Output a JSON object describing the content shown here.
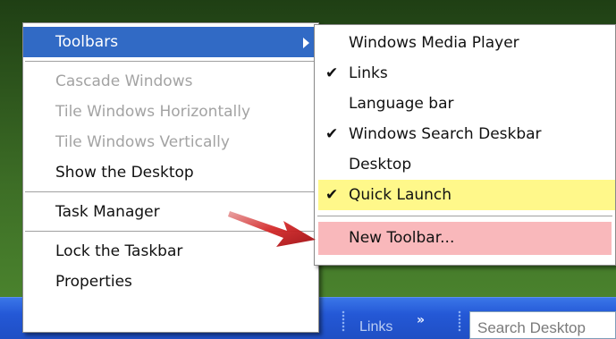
{
  "context_menu": {
    "items": [
      {
        "label": "Toolbars",
        "state": "highlighted",
        "has_submenu": true
      },
      {
        "label": "Cascade Windows",
        "state": "disabled"
      },
      {
        "label": "Tile Windows Horizontally",
        "state": "disabled"
      },
      {
        "label": "Tile Windows Vertically",
        "state": "disabled"
      },
      {
        "label": "Show the Desktop",
        "state": "enabled"
      },
      {
        "label": "Task Manager",
        "state": "enabled"
      },
      {
        "label": "Lock the Taskbar",
        "state": "enabled"
      },
      {
        "label": "Properties",
        "state": "enabled"
      }
    ]
  },
  "toolbars_submenu": {
    "check_glyph": "✔",
    "items": [
      {
        "label": "Windows Media Player",
        "checked": false
      },
      {
        "label": "Links",
        "checked": true
      },
      {
        "label": "Language bar",
        "checked": false
      },
      {
        "label": "Windows Search Deskbar",
        "checked": true
      },
      {
        "label": "Desktop",
        "checked": false
      },
      {
        "label": "Quick Launch",
        "checked": true,
        "highlight_color": "#fff88a"
      }
    ],
    "new_toolbar": {
      "label": "New Toolbar...",
      "highlight_color": "#f9b8bb"
    }
  },
  "taskbar": {
    "links_label": "Links",
    "chevron": "»",
    "search_text": "Search Desktop",
    "color": "#2458d6"
  },
  "annotation": {
    "arrow_icon": "red-arrow-icon",
    "arrow_color": "#c8141c"
  },
  "colors": {
    "menu_highlight": "#316ac5",
    "disabled_text": "#a3a3a3"
  }
}
